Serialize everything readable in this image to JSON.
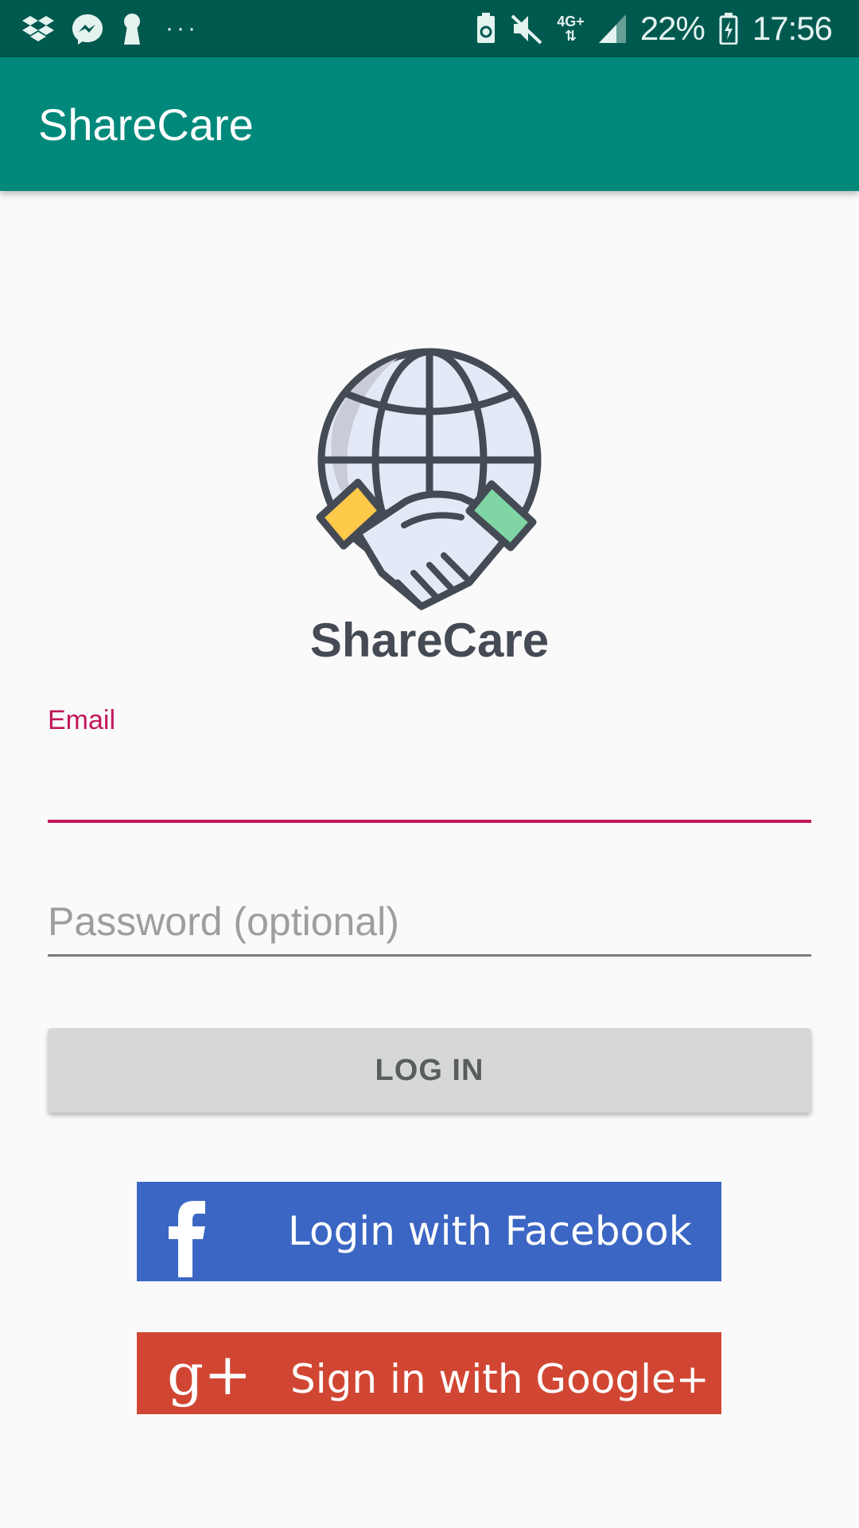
{
  "status_bar": {
    "battery": "22%",
    "time": "17:56",
    "network": "4G+",
    "more": "···",
    "icons": [
      "dropbox-icon",
      "messenger-icon",
      "keyhole-icon",
      "more-icon",
      "battery-saver-icon",
      "mute-icon",
      "network-4g-icon",
      "signal-icon",
      "battery-charging-icon"
    ]
  },
  "app_bar": {
    "title": "ShareCare"
  },
  "logo": {
    "text": "ShareCare",
    "icon": "globe-handshake-logo"
  },
  "form": {
    "email_label": "Email",
    "email_value": "",
    "password_placeholder": "Password (optional)",
    "password_value": "",
    "login_label": "LOG IN"
  },
  "social": {
    "facebook_label": "Login with Facebook",
    "google_label": "Sign in with Google+",
    "google_icon_text": "g+"
  },
  "colors": {
    "status_bar": "#00594f",
    "app_bar": "#00897b",
    "accent": "#c2185b",
    "facebook": "#3b66c4",
    "google": "#d14633"
  }
}
